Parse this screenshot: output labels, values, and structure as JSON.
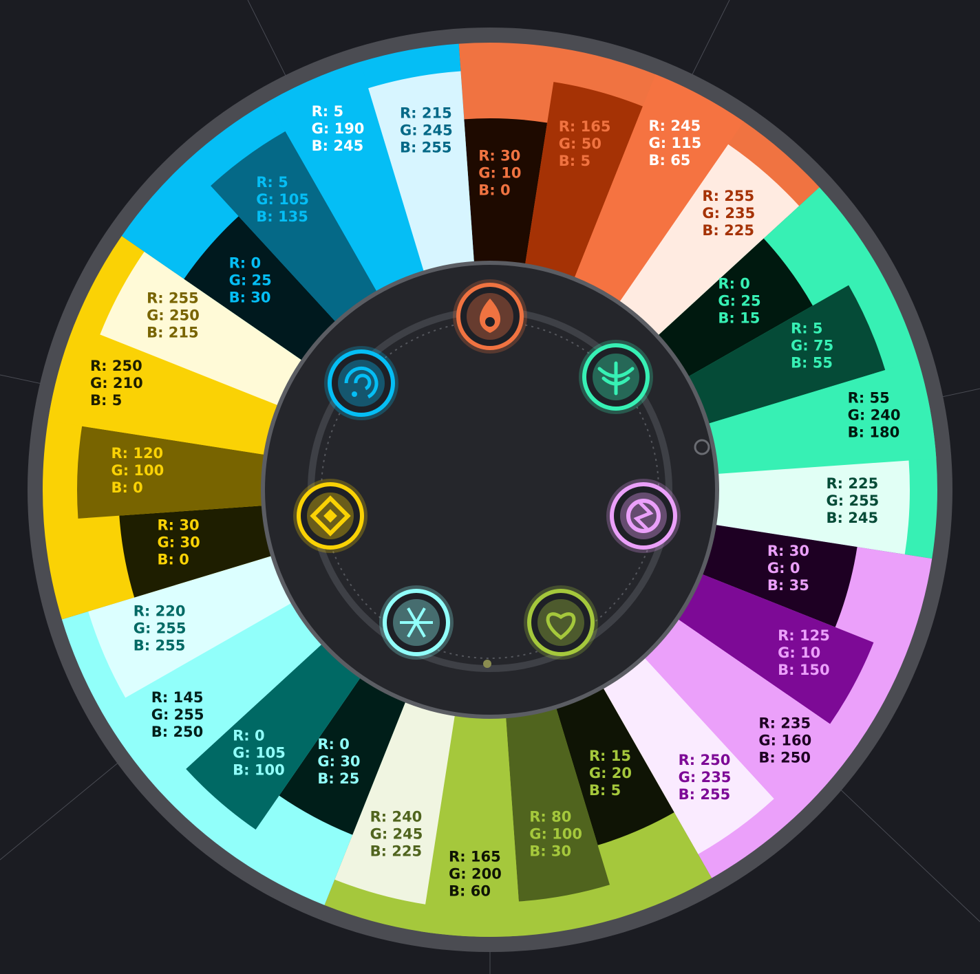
{
  "background": "#1b1c22",
  "elements": [
    {
      "name": "pyro",
      "icon": "pyro-flame-icon",
      "accent": "#f07341",
      "swatches": [
        {
          "rgb": [
            30,
            10,
            0
          ],
          "lines": [
            "R: 30",
            "G: 10",
            "B: 0"
          ]
        },
        {
          "rgb": [
            165,
            50,
            5
          ],
          "lines": [
            "R: 165",
            "G: 50",
            "B: 5"
          ]
        },
        {
          "rgb": [
            245,
            115,
            65
          ],
          "lines": [
            "R: 245",
            "G: 115",
            "B: 65"
          ]
        },
        {
          "rgb": [
            255,
            235,
            225
          ],
          "lines": [
            "R: 255",
            "G: 235",
            "B: 225"
          ]
        }
      ]
    },
    {
      "name": "anemo",
      "icon": "anemo-wind-icon",
      "accent": "#37f0b4",
      "swatches": [
        {
          "rgb": [
            0,
            25,
            15
          ],
          "lines": [
            "R: 0",
            "G: 25",
            "B: 15"
          ]
        },
        {
          "rgb": [
            5,
            75,
            55
          ],
          "lines": [
            "R: 5",
            "G: 75",
            "B: 55"
          ]
        },
        {
          "rgb": [
            55,
            240,
            180
          ],
          "lines": [
            "R: 55",
            "G: 240",
            "B: 180"
          ]
        },
        {
          "rgb": [
            225,
            255,
            245
          ],
          "lines": [
            "R: 225",
            "G: 255",
            "B: 245"
          ]
        }
      ]
    },
    {
      "name": "electro",
      "icon": "electro-lightning-icon",
      "accent": "#eba0fa",
      "swatches": [
        {
          "rgb": [
            30,
            0,
            35
          ],
          "lines": [
            "R: 30",
            "G: 0",
            "B: 35"
          ]
        },
        {
          "rgb": [
            125,
            10,
            150
          ],
          "lines": [
            "R: 125",
            "G: 10",
            "B: 150"
          ]
        },
        {
          "rgb": [
            235,
            160,
            250
          ],
          "lines": [
            "R: 235",
            "G: 160",
            "B: 250"
          ]
        },
        {
          "rgb": [
            250,
            235,
            255
          ],
          "lines": [
            "R: 250",
            "G: 235",
            "B: 255"
          ]
        }
      ]
    },
    {
      "name": "dendro",
      "icon": "dendro-leaf-icon",
      "accent": "#a5c83c",
      "swatches": [
        {
          "rgb": [
            15,
            20,
            5
          ],
          "lines": [
            "R: 15",
            "G: 20",
            "B: 5"
          ]
        },
        {
          "rgb": [
            80,
            100,
            30
          ],
          "lines": [
            "R: 80",
            "G: 100",
            "B: 30"
          ]
        },
        {
          "rgb": [
            165,
            200,
            60
          ],
          "lines": [
            "R: 165",
            "G: 200",
            "B: 60"
          ]
        },
        {
          "rgb": [
            240,
            245,
            225
          ],
          "lines": [
            "R: 240",
            "G: 245",
            "B: 225"
          ]
        }
      ]
    },
    {
      "name": "cryo",
      "icon": "cryo-snowflake-icon",
      "accent": "#91fffa",
      "swatches": [
        {
          "rgb": [
            0,
            30,
            25
          ],
          "lines": [
            "R: 0",
            "G: 30",
            "B: 25"
          ]
        },
        {
          "rgb": [
            0,
            105,
            100
          ],
          "lines": [
            "R: 0",
            "G: 105",
            "B: 100"
          ]
        },
        {
          "rgb": [
            145,
            255,
            250
          ],
          "lines": [
            "R: 145",
            "G: 255",
            "B: 250"
          ]
        },
        {
          "rgb": [
            220,
            255,
            255
          ],
          "lines": [
            "R: 220",
            "G: 255",
            "B: 255"
          ]
        }
      ]
    },
    {
      "name": "geo",
      "icon": "geo-stone-icon",
      "accent": "#fad205",
      "swatches": [
        {
          "rgb": [
            30,
            30,
            0
          ],
          "lines": [
            "R: 30",
            "G: 30",
            "B: 0"
          ]
        },
        {
          "rgb": [
            120,
            100,
            0
          ],
          "lines": [
            "R: 120",
            "G: 100",
            "B: 0"
          ]
        },
        {
          "rgb": [
            250,
            210,
            5
          ],
          "lines": [
            "R: 250",
            "G: 210",
            "B: 5"
          ]
        },
        {
          "rgb": [
            255,
            250,
            215
          ],
          "lines": [
            "R: 255",
            "G: 250",
            "B: 215"
          ]
        }
      ]
    },
    {
      "name": "hydro",
      "icon": "hydro-water-icon",
      "accent": "#05bef5",
      "swatches": [
        {
          "rgb": [
            0,
            25,
            30
          ],
          "lines": [
            "R: 0",
            "G: 25",
            "B: 30"
          ]
        },
        {
          "rgb": [
            5,
            105,
            135
          ],
          "lines": [
            "R: 5",
            "G: 105",
            "B: 135"
          ]
        },
        {
          "rgb": [
            5,
            190,
            245
          ],
          "lines": [
            "R: 5",
            "G: 190",
            "B: 245"
          ]
        },
        {
          "rgb": [
            215,
            245,
            255
          ],
          "lines": [
            "R: 215",
            "G: 245",
            "B: 255"
          ]
        }
      ]
    }
  ]
}
